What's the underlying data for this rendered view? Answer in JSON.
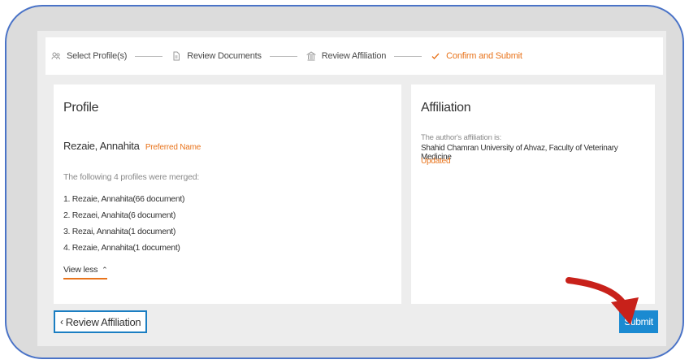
{
  "stepper": {
    "steps": [
      {
        "label": "Select Profile(s)",
        "icon": "users-icon"
      },
      {
        "label": "Review Documents",
        "icon": "document-icon"
      },
      {
        "label": "Review Affiliation",
        "icon": "building-icon"
      },
      {
        "label": "Confirm and Submit",
        "icon": "check-icon"
      }
    ],
    "active_color": "#e8731b"
  },
  "profile": {
    "title": "Profile",
    "name": "Rezaie, Annahita",
    "preferred_label": "Preferred Name",
    "merged_note": "The following 4 profiles were merged:",
    "merged": [
      "1. Rezaie, Annahita(66 document)",
      "2. Rezaei, Anahita(6 document)",
      "3. Rezai, Annahita(1 document)",
      "4. Rezaie, Annahita(1 document)"
    ],
    "view_less": "View less"
  },
  "affiliation": {
    "title": "Affiliation",
    "label": "The author's affiliation is:",
    "value": "Shahid Chamran University of Ahvaz, Faculty of Veterinary Medicine",
    "status": "Updated"
  },
  "footer": {
    "back_label": "Review Affiliation",
    "submit_label": "Submit"
  },
  "colors": {
    "frame_border": "#4a73c7",
    "accent": "#e8731b",
    "primary_button": "#1b8ad1",
    "arrow": "#c8211a"
  }
}
